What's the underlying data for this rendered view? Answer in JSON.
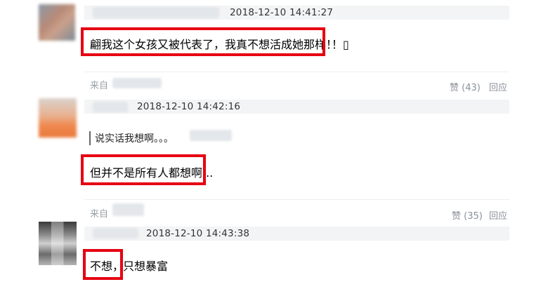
{
  "comments": [
    {
      "timestamp": "2018-12-10 14:41:27",
      "text": "翩我这个女孩又被代表了，我真不想活成她那样！",
      "trail": "！▯",
      "source_prefix": "来自",
      "like_label": "赞",
      "like_count": "(43)",
      "reply_label": "回应"
    },
    {
      "timestamp": "2018-12-10 14:42:16",
      "quote": "说实话我想啊。。。",
      "text": "但并不是所有人都想啊...",
      "source_prefix": "来自",
      "like_label": "赞",
      "like_count": "(35)",
      "reply_label": "回应"
    },
    {
      "timestamp": "2018-12-10 14:43:38",
      "text": "不想，",
      "text_rest": "只想暴富"
    }
  ],
  "colors": {
    "highlight": "#e60012",
    "meta": "#9aa0a6"
  }
}
